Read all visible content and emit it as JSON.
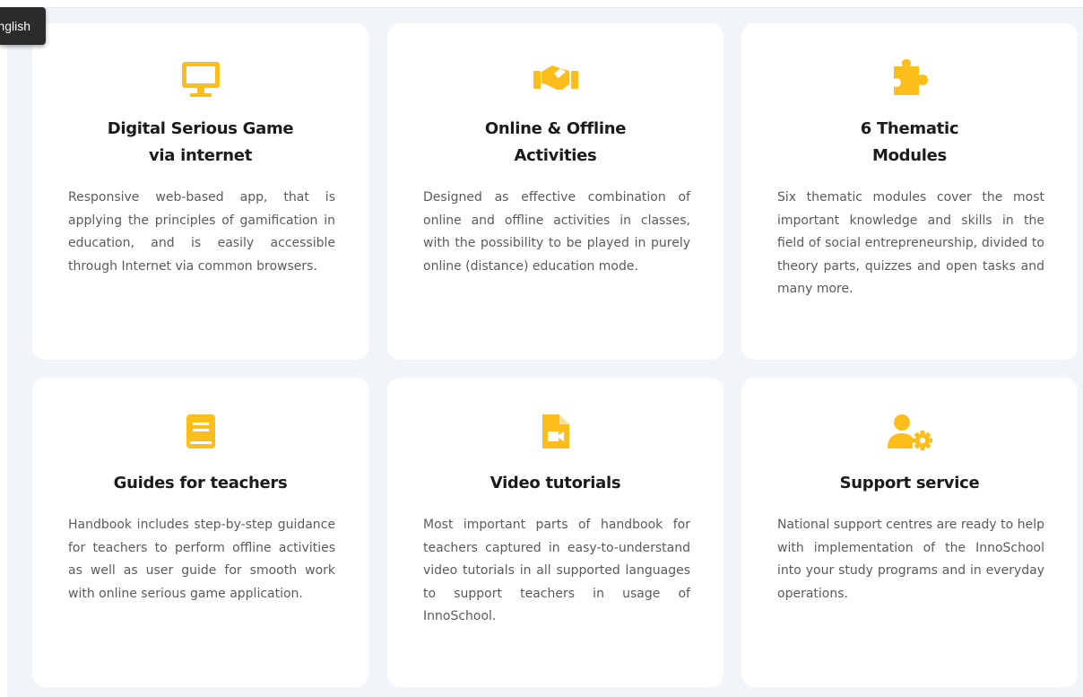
{
  "language_switcher": {
    "label": "English"
  },
  "accent_color": "#FDBE1B",
  "features": [
    {
      "icon": "monitor-icon",
      "title_line1": "Digital Serious Game",
      "title_line2": "via internet",
      "description": "Responsive web-based app, that is applying the principles of gamification in education, and is easily accessible through Internet via common browsers."
    },
    {
      "icon": "handshake-icon",
      "title_line1": "Online & Offline",
      "title_line2": "Activities",
      "description": "Designed as effective combination of online and offline activities in classes, with the possibility to be played in purely online (distance) education mode."
    },
    {
      "icon": "puzzle-piece-icon",
      "title_line1": "6 Thematic",
      "title_line2": "Modules",
      "description": "Six thematic modules cover the most important knowledge and skills in the field of social entrepreneurship, divided to theory parts, quizzes and open tasks and many more."
    },
    {
      "icon": "book-icon",
      "title_line1": "Guides for teachers",
      "description": "Handbook includes step-by-step guidance for teachers to perform offline activities as well as user guide for smooth work with online serious game application."
    },
    {
      "icon": "video-file-icon",
      "title_line1": "Video tutorials",
      "description": "Most important parts of handbook for teachers captured in easy-to-understand video tutorials in all supported languages to support teachers in usage of InnoSchool."
    },
    {
      "icon": "user-gear-icon",
      "title_line1": "Support service",
      "description": "National support centres are ready to help with implementation of the InnoSchool into your study programs and in everyday operations."
    }
  ]
}
